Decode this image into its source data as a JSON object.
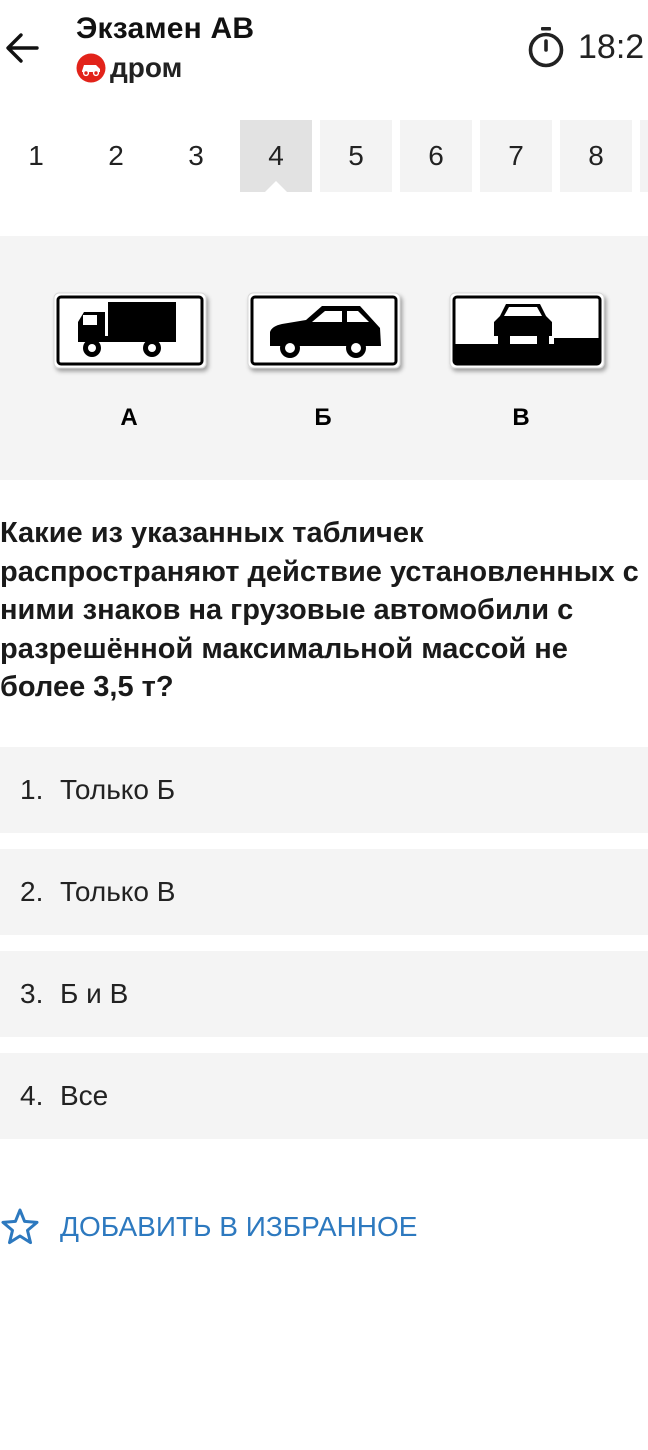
{
  "header": {
    "title": "Экзамен АВ",
    "brand": "дром",
    "timer": "18:2"
  },
  "tabs": [
    {
      "label": "1"
    },
    {
      "label": "2"
    },
    {
      "label": "3"
    },
    {
      "label": "4"
    },
    {
      "label": "5"
    },
    {
      "label": "6"
    },
    {
      "label": "7"
    },
    {
      "label": "8"
    }
  ],
  "active_tab": "4",
  "image": {
    "sign_labels": [
      "А",
      "Б",
      "В"
    ]
  },
  "question": "Какие из указанных табличек распространяют действие установленных с ними знаков на грузовые автомобили с разрешённой максимальной массой не более 3,5 т?",
  "answers": [
    {
      "number": "1.",
      "text": "Только Б"
    },
    {
      "number": "2.",
      "text": "Только В"
    },
    {
      "number": "3.",
      "text": "Б и В"
    },
    {
      "number": "4.",
      "text": "Все"
    }
  ],
  "favorite_label": "ДОБАВИТЬ В ИЗБРАННОЕ",
  "colors": {
    "accent": "#2d79bf",
    "brand_red": "#e2231a",
    "panel_bg": "#f4f4f4",
    "tab_active": "#e2e2e2"
  }
}
